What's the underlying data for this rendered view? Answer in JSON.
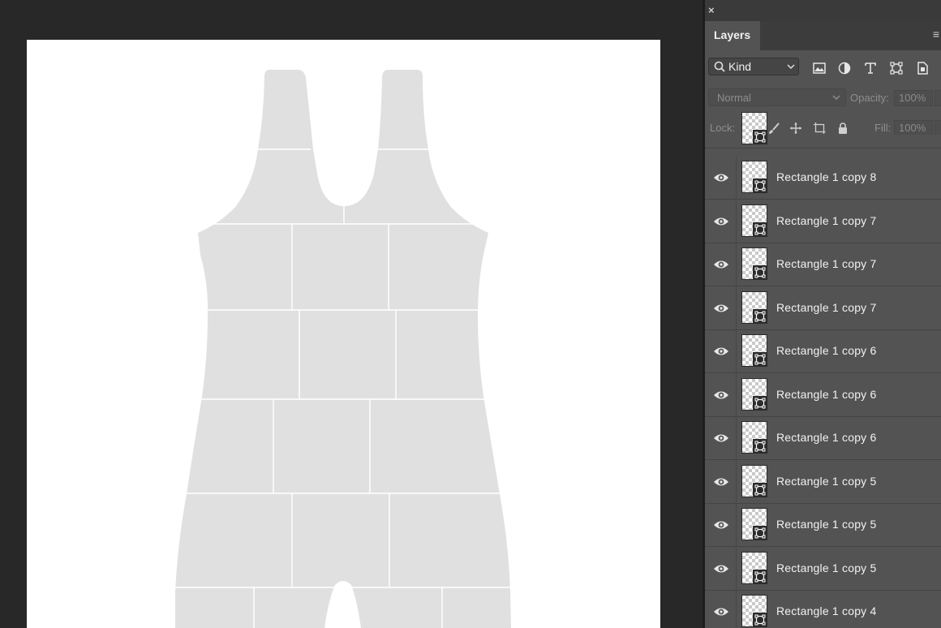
{
  "panel": {
    "close_glyph": "×",
    "tab_label": "Layers",
    "menu_glyph": "≡",
    "filter": {
      "kind_label": "Kind",
      "icons": [
        "image-filter-icon",
        "adjustment-filter-icon",
        "type-filter-icon",
        "shape-filter-icon",
        "smart-object-filter-icon"
      ]
    },
    "blend_mode": "Normal",
    "opacity_label": "Opacity:",
    "opacity_value": "100%",
    "lock_label": "Lock:",
    "lock_icons": [
      "lock-transparent-pixels-icon",
      "lock-image-pixels-icon",
      "lock-position-icon",
      "lock-artboard-icon",
      "lock-all-icon"
    ],
    "fill_label": "Fill:",
    "fill_value": "100%"
  },
  "layers": [
    {
      "name": "Rectangle 1 copy 8",
      "visible": true
    },
    {
      "name": "Rectangle 1 copy 7",
      "visible": true
    },
    {
      "name": "Rectangle 1 copy 7",
      "visible": true
    },
    {
      "name": "Rectangle 1 copy 7",
      "visible": true
    },
    {
      "name": "Rectangle 1 copy 6",
      "visible": true
    },
    {
      "name": "Rectangle 1 copy 6",
      "visible": true
    },
    {
      "name": "Rectangle 1 copy 6",
      "visible": true
    },
    {
      "name": "Rectangle 1 copy 5",
      "visible": true
    },
    {
      "name": "Rectangle 1 copy 5",
      "visible": true
    },
    {
      "name": "Rectangle 1 copy 5",
      "visible": true
    },
    {
      "name": "Rectangle 1 copy 4",
      "visible": true
    }
  ],
  "colors": {
    "workspace": "#282828",
    "panel": "#535353",
    "canvas": "#ffffff",
    "garment_fill": "#e0e0e0",
    "seam_lines": "#ffffff"
  }
}
